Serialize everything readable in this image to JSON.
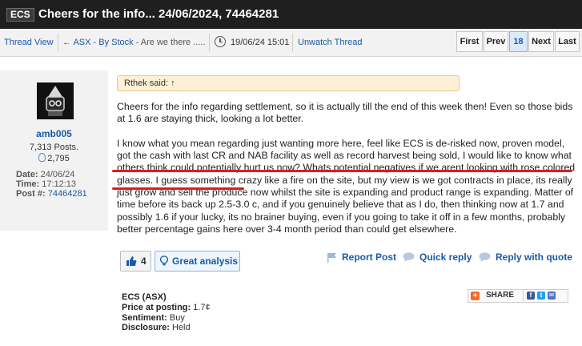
{
  "header": {
    "badge": "ECS",
    "title": "Cheers for the info... 24/06/2024, 74464281"
  },
  "nav": {
    "thread_view": "Thread View",
    "back_link": "← ASX - By Stock",
    "back_suffix": " - Are we there .....",
    "date": "19/06/24 15:01",
    "unwatch": "Unwatch Thread",
    "pagination": [
      "First",
      "Prev",
      "18",
      "Next",
      "Last"
    ]
  },
  "author": {
    "username": "amb005",
    "posts": "7,313 Posts.",
    "likes": "2,795",
    "date_label": "Date:",
    "date": "24/06/24",
    "time_label": "Time:",
    "time": "17:12:13",
    "post_label": "Post #:",
    "post_number": "74464281"
  },
  "quote": {
    "text": "Rthek said: ↑"
  },
  "post": {
    "paragraph1": "Cheers for the info regarding settlement, so it is actually till the end of this week then! Even so those bids at 1.6 are staying thick, looking a lot better.",
    "paragraph2": "I know what you mean regarding just wanting more here, feel like ECS is de-risked now, proven model, got the cash with last CR and NAB facility as well as record harvest being sold, I would like to know what others think could potentially hurt us now? Whats potential negatives if we arent looking with rose colored glasses. I guess something crazy like a fire on the site, but my view is we got contracts in place, its really just grow and sell the produce now whilst the site is expanding and product range is expanding. Matter of time before its back up 2.5-3.0 c, and if you genuinely believe that as I do, then thinking now at 1.7 and possibly 1.6 if your lucky, its no brainer buying, even if you going to take it off in a few months, probably better percentage gains here over 3-4 month period than could get elsewhere."
  },
  "actions": {
    "like_count": "4",
    "great_analysis": "Great analysis",
    "report": "Report Post",
    "quick_reply": "Quick reply",
    "reply_quote": "Reply with quote"
  },
  "disclosure": {
    "stock": "ECS (ASX)",
    "price_label": "Price at posting:",
    "price": "1.7¢",
    "sentiment_label": "Sentiment:",
    "sentiment": "Buy",
    "disclosure_label": "Disclosure:",
    "disclosure": "Held"
  },
  "share": {
    "label": "SHARE"
  },
  "colors": {
    "link": "#1a5aa8",
    "highlight_underline": "#e01c1c",
    "titlebar": "#1f1f1f"
  }
}
